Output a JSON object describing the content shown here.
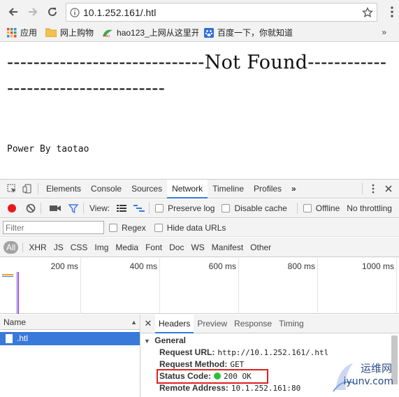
{
  "browser": {
    "url": "10.1.252.161/.htl",
    "bookmarks": [
      {
        "label": "应用",
        "icon": "apps-grid-icon"
      },
      {
        "label": "网上购物",
        "icon": "folder-icon"
      },
      {
        "label": "hao123_上网从这里开",
        "icon": "hao123-icon"
      },
      {
        "label": "百度一下，你就知道",
        "icon": "baidu-paw-icon"
      }
    ],
    "bookmarks_overflow": "»"
  },
  "page": {
    "headline": "------------------------------Not Found------------------------------------",
    "powered_by": "Power By taotao"
  },
  "devtools": {
    "tabs": [
      "Elements",
      "Console",
      "Sources",
      "Network",
      "Timeline",
      "Profiles"
    ],
    "active_tab": "Network",
    "overflow": "»",
    "toolbar": {
      "view_label": "View:",
      "preserve_log": "Preserve log",
      "disable_cache": "Disable cache",
      "offline": "Offline",
      "throttling": "No throttling"
    },
    "filter": {
      "placeholder": "Filter",
      "regex": "Regex",
      "hide_data_urls": "Hide data URLs"
    },
    "types": [
      "All",
      "XHR",
      "JS",
      "CSS",
      "Img",
      "Media",
      "Font",
      "Doc",
      "WS",
      "Manifest",
      "Other"
    ],
    "timeline_labels": [
      "200 ms",
      "400 ms",
      "600 ms",
      "800 ms",
      "1000 ms"
    ],
    "name_header": "Name",
    "requests": [
      ".htl"
    ],
    "detail_tabs": [
      "Headers",
      "Preview",
      "Response",
      "Timing"
    ],
    "active_detail_tab": "Headers",
    "general_title": "General",
    "headers": {
      "request_url_key": "Request URL:",
      "request_url_val": "http://10.1.252.161/.htl",
      "request_method_key": "Request Method:",
      "request_method_val": "GET",
      "status_code_key": "Status Code:",
      "status_code_val": "200 OK",
      "remote_address_key": "Remote Address:",
      "remote_address_val": "10.1.252.161:80"
    }
  },
  "watermark": {
    "line1": "运维网",
    "line2": "iyunv.com"
  },
  "colors": {
    "accent": "#3879d9",
    "status_ok": "#2fbf3a",
    "highlight_box": "#e02020",
    "record": "#e51c1c",
    "filter_blue": "#3879d9"
  }
}
